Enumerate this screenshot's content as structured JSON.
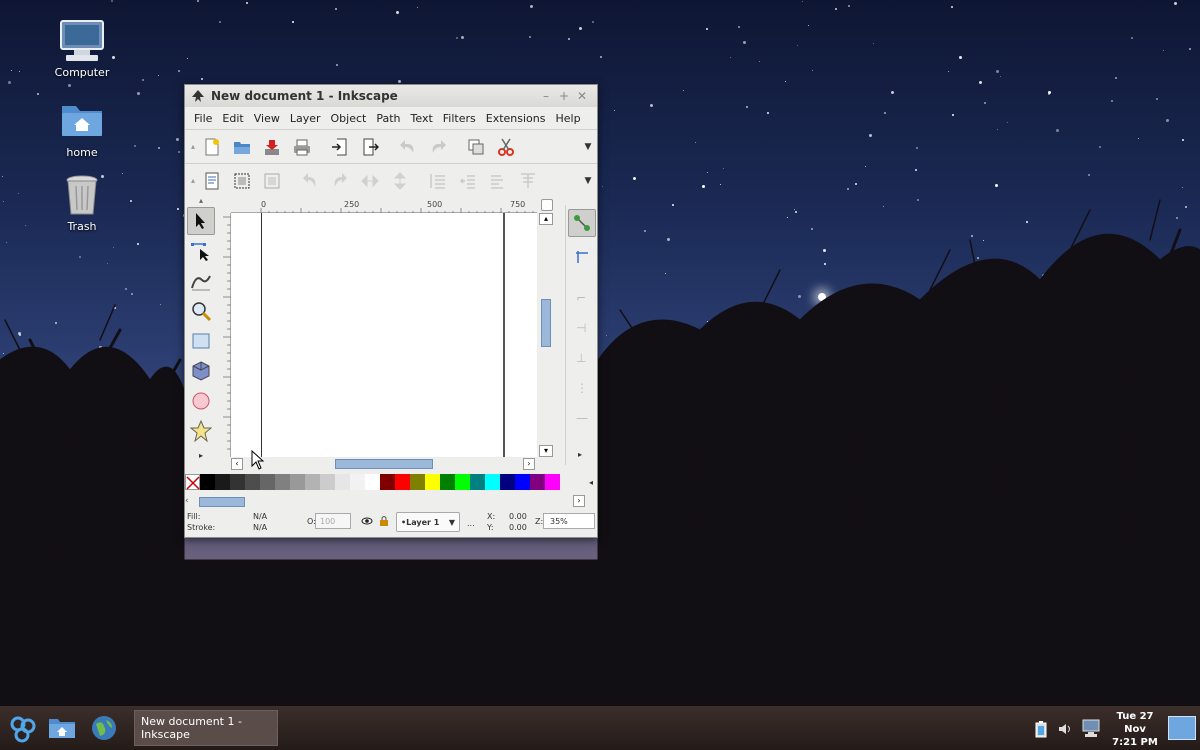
{
  "desktop": {
    "icons": [
      {
        "label": "Computer"
      },
      {
        "label": "home"
      },
      {
        "label": "Trash"
      }
    ]
  },
  "window": {
    "title": "New document 1 - Inkscape",
    "menu": [
      "File",
      "Edit",
      "View",
      "Layer",
      "Object",
      "Path",
      "Text",
      "Filters",
      "Extensions",
      "Help"
    ],
    "ruler_labels": [
      "0",
      "250",
      "500",
      "750"
    ],
    "status": {
      "fill_label": "Fill:",
      "fill_value": "N/A",
      "stroke_label": "Stroke:",
      "stroke_value": "N/A",
      "opacity_label": "O:",
      "opacity_value": "100",
      "layer": "•Layer 1",
      "ellipsis": "...",
      "x_label": "X:",
      "x_value": "0.00",
      "y_label": "Y:",
      "y_value": "0.00",
      "zoom_label": "Z:",
      "zoom_value": "35%"
    },
    "palette": [
      "#000000",
      "#1a1a1a",
      "#333333",
      "#4d4d4d",
      "#666666",
      "#808080",
      "#999999",
      "#b3b3b3",
      "#cccccc",
      "#e6e6e6",
      "#f2f2f2",
      "#ffffff",
      "#800000",
      "#ff0000",
      "#808000",
      "#ffff00",
      "#008000",
      "#00ff00",
      "#008080",
      "#00ffff",
      "#000080",
      "#0000ff",
      "#800080",
      "#ff00ff"
    ]
  },
  "taskbar": {
    "task_label": "New document 1 - Inkscape",
    "clock_date": "Tue 27 Nov",
    "clock_time": "7:21 PM"
  }
}
